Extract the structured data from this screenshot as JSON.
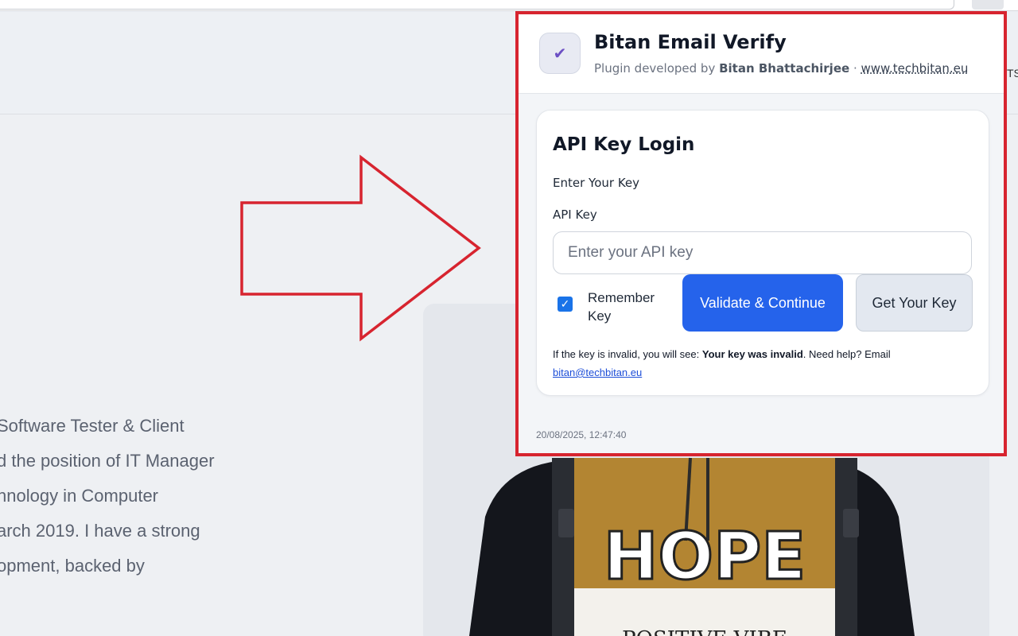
{
  "background": {
    "nav_cut_text": "TS",
    "bio_lines": [
      "Software Tester & Client",
      "d the position of IT Manager",
      "hnology in Computer",
      "arch 2019. I have a strong",
      "opment, backed by"
    ],
    "photo": {
      "shirt_text": "HOPE",
      "shirt_bottom_text": "POSITIVE VIBE"
    }
  },
  "popup": {
    "title": "Bitan Email Verify",
    "subtitle_prefix": "Plugin developed by",
    "developer": "Bitan Bhattachirjee",
    "separator": "·",
    "website": "www.techbitan.eu",
    "logo_icon": "checkmark-icon",
    "card": {
      "title": "API Key Login",
      "subtitle": "Enter Your Key",
      "field_label": "API Key",
      "input_value": "",
      "input_placeholder": "Enter your API key",
      "remember_label": "Remember Key",
      "remember_checked": true,
      "validate_button": "Validate & Continue",
      "get_key_button": "Get Your Key",
      "help_prefix": "If the key is invalid, you will see:",
      "help_bold": "Your key was invalid",
      "help_middle": ". Need help? Email",
      "help_email": "bitan@techbitan.eu"
    },
    "timestamp": "20/08/2025, 12:47:40"
  },
  "colors": {
    "highlight_border": "#d7242f",
    "primary_button": "#2563eb",
    "checkbox": "#1a73e8",
    "arrow": "#d7242f"
  }
}
